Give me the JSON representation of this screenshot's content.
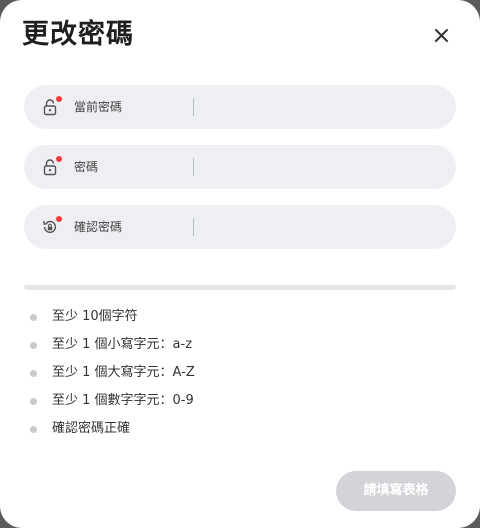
{
  "dialog": {
    "title": "更改密碼"
  },
  "fields": [
    {
      "label": "當前密碼",
      "value": "",
      "icon": "lock-icon",
      "required_indicator_color": "#f03d3d"
    },
    {
      "label": "密碼",
      "value": "",
      "icon": "lock-icon",
      "required_indicator_color": "#f03d3d"
    },
    {
      "label": "確認密碼",
      "value": "",
      "icon": "lock-reset-icon",
      "required_indicator_color": "#f03d3d"
    }
  ],
  "password_strength": 0,
  "requirements": [
    {
      "text": "至少 10個字符",
      "met": false
    },
    {
      "text": "至少 1 個小寫字元：a-z",
      "met": false
    },
    {
      "text": "至少 1 個大寫字元：A-Z",
      "met": false
    },
    {
      "text": "至少 1 個數字字元：0-9",
      "met": false
    },
    {
      "text": "確認密碼正確",
      "met": false
    }
  ],
  "submit_button": {
    "label": "請填寫表格",
    "disabled": true
  },
  "colors": {
    "field_bg": "#edeff2",
    "required_dot": "#f03d3d",
    "button_disabled_bg": "#d2d4d7"
  }
}
